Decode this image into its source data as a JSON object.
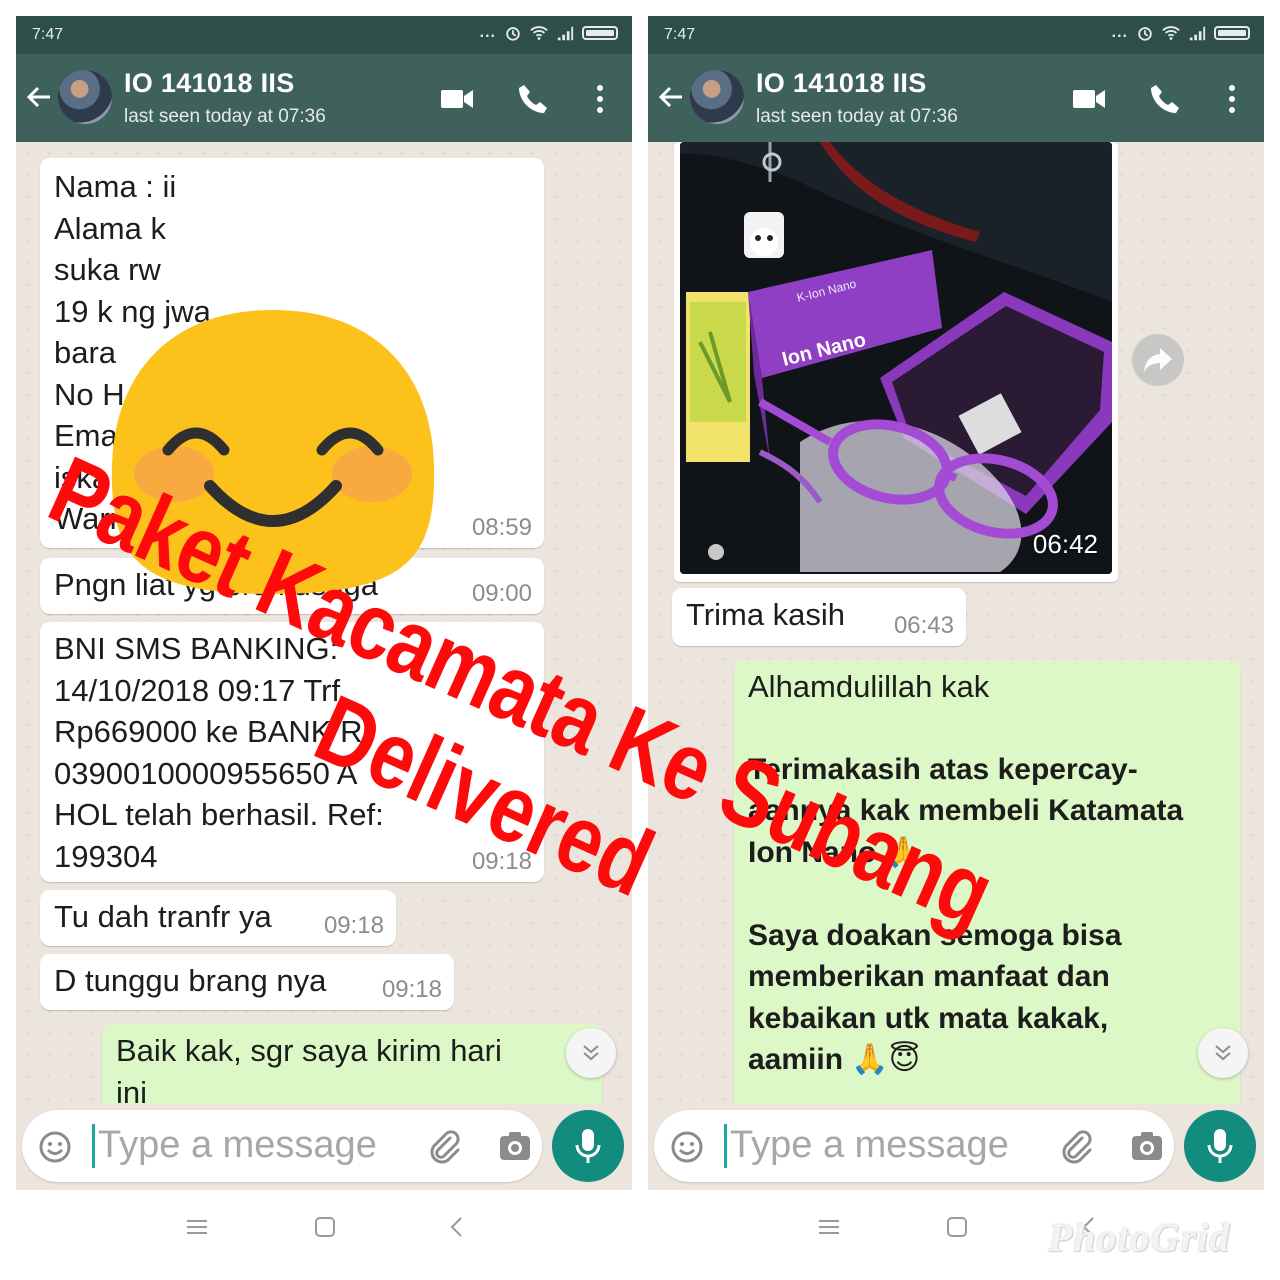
{
  "status": {
    "time": "7:47",
    "dots": "..."
  },
  "contact": {
    "name": "IO 141018 IIS",
    "last_seen": "last seen today at 07:36"
  },
  "left_chat": {
    "messages": [
      {
        "text": "Nama : ii\nAlama                         k\nsuka                          rw\n19 k                          ng jwa\nbara\nNo H                         0\nEmail :\niska          i1078@gmail.com\nWarna  ka    mata : Ungu",
        "time": "08:59",
        "email_visible": "i1078@gmail.com"
      },
      {
        "text": "Pngn liat yg bru kusuga",
        "time": "09:00"
      },
      {
        "text": "BNI SMS BANKING:\n14/10/2018 09:17 Trf\nRp669000 ke BANK R\n0390010000955650 A\nHOL telah berhasil. Ref:\n199304",
        "time": "09:18"
      },
      {
        "text": "Tu dah tranfr ya",
        "time": "09:18"
      },
      {
        "text": "D tunggu brang nya",
        "time": "09:18"
      },
      {
        "text": "Baik kak, sgr saya kirim hari\nini",
        "time": ""
      }
    ]
  },
  "right_chat": {
    "image": {
      "time": "06:42",
      "brand_box": "Ion Nano",
      "brand_small": "K-Ion Nano"
    },
    "messages": [
      {
        "text": "Trima kasih",
        "time": "06:43"
      },
      {
        "text": "Alhamdulillah kak",
        "time": ""
      },
      {
        "text": "Terimakasih atas kepercay-\naannya kak membeli Katamata\nIon Nano 🙏\n\nSaya doakan semoga bisa\nmemberikan manfaat dan\nkebaikan utk mata kakak,\naamiin 🙏😇",
        "time": ""
      }
    ]
  },
  "input": {
    "placeholder": "Type a message"
  },
  "overlay": {
    "line1": "Paket Kacamata Ke Subang",
    "line2": "Delivered"
  },
  "watermark": "PhotoGrid",
  "colors": {
    "header": "#3f615b",
    "statusbar": "#2e4e49",
    "outgoing": "#dcf8c6",
    "accent": "#128c7e",
    "stamp": "#ff0a0a"
  }
}
